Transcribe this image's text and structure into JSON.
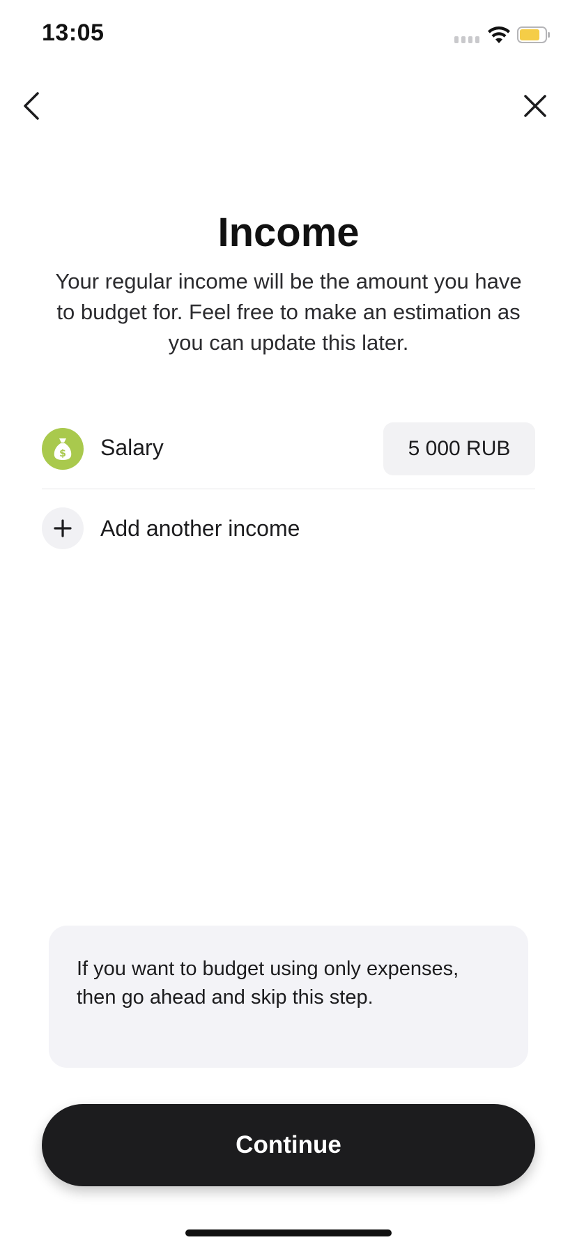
{
  "status_bar": {
    "time": "13:05",
    "icons": [
      "cellular-signal-icon",
      "wifi-icon",
      "battery-icon"
    ],
    "battery_color": "#f5cd47"
  },
  "nav": {
    "back_icon": "chevron-left-icon",
    "close_icon": "close-icon"
  },
  "header": {
    "title": "Income",
    "subtitle": "Your regular income will be the amount you have to budget for. Feel free to make an estimation as you can update this later."
  },
  "incomes": [
    {
      "icon": "money-bag-icon",
      "icon_color": "#a9c94d",
      "label": "Salary",
      "amount": "5 000 RUB"
    }
  ],
  "add_income": {
    "icon": "plus-icon",
    "label": "Add another income"
  },
  "info": {
    "text": "If you want to budget using only expenses, then go ahead and skip this step."
  },
  "footer": {
    "continue_label": "Continue"
  },
  "colors": {
    "primary_button": "#1c1c1e",
    "info_background": "#f3f3f7",
    "amount_background": "#f2f2f4"
  }
}
